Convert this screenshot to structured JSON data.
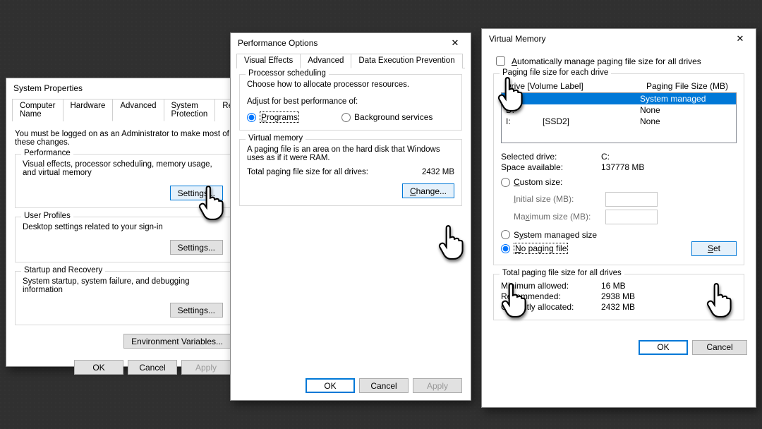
{
  "win1": {
    "title": "System Properties",
    "tabs": [
      "Computer Name",
      "Hardware",
      "Advanced",
      "System Protection",
      "Remote"
    ],
    "active_tab": "Advanced",
    "note": "You must be logged on as an Administrator to make most of these changes.",
    "perf": {
      "title": "Performance",
      "desc": "Visual effects, processor scheduling, memory usage, and virtual memory",
      "btn": "Settings..."
    },
    "profiles": {
      "title": "User Profiles",
      "desc": "Desktop settings related to your sign-in",
      "btn": "Settings..."
    },
    "startup": {
      "title": "Startup and Recovery",
      "desc": "System startup, system failure, and debugging information",
      "btn": "Settings..."
    },
    "envbtn": "Environment Variables...",
    "ok": "OK",
    "cancel": "Cancel",
    "apply": "Apply"
  },
  "win2": {
    "title": "Performance Options",
    "tabs": [
      "Visual Effects",
      "Advanced",
      "Data Execution Prevention"
    ],
    "active_tab": "Advanced",
    "sched": {
      "title": "Processor scheduling",
      "desc": "Choose how to allocate processor resources.",
      "adjust": "Adjust for best performance of:",
      "opt_programs": "Programs",
      "opt_bg": "Background services"
    },
    "vm": {
      "title": "Virtual memory",
      "desc": "A paging file is an area on the hard disk that Windows uses as if it were RAM.",
      "total_label": "Total paging file size for all drives:",
      "total_value": "2432 MB",
      "btn": "Change..."
    },
    "ok": "OK",
    "cancel": "Cancel",
    "apply": "Apply"
  },
  "win3": {
    "title": "Virtual Memory",
    "auto": "Automatically manage paging file size for all drives",
    "pfs_each": "Paging file size for each drive",
    "hdr_drive": "Drive  [Volume Label]",
    "hdr_size": "Paging File Size (MB)",
    "rows": [
      {
        "d": "C:",
        "v": "",
        "s": "System managed"
      },
      {
        "d": "D:",
        "v": "",
        "s": "None"
      },
      {
        "d": "I:",
        "v": "[SSD2]",
        "s": "None"
      }
    ],
    "sel_drive_label": "Selected drive:",
    "sel_drive_value": "C:",
    "space_label": "Space available:",
    "space_value": "137778 MB",
    "custom": "Custom size:",
    "init": "Initial size (MB):",
    "max": "Maximum size (MB):",
    "sysman": "System managed size",
    "nopf": "No paging file",
    "setbtn": "Set",
    "totals_title": "Total paging file size for all drives",
    "min_l": "Minimum allowed:",
    "min_v": "16 MB",
    "rec_l": "Recommended:",
    "rec_v": "2938 MB",
    "cur_l": "Currently allocated:",
    "cur_v": "2432 MB",
    "ok": "OK",
    "cancel": "Cancel"
  }
}
